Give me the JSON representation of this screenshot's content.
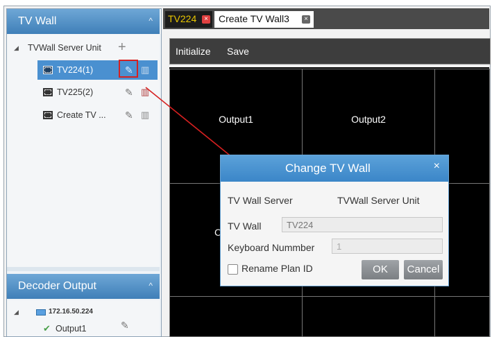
{
  "left_panel": {
    "tv_wall_header": "TV Wall",
    "server_unit_label": "TVWall Server Unit",
    "walls": [
      {
        "label": "TV224(1)"
      },
      {
        "label": "TV225(2)"
      },
      {
        "label": "Create TV ..."
      }
    ],
    "decoder_header": "Decoder Output",
    "decoder_ip": "172.16.50.224",
    "decoder_output": "Output1"
  },
  "tabs": [
    {
      "label": "TV224"
    },
    {
      "label": "Create TV Wall3"
    }
  ],
  "toolbar": {
    "initialize": "Initialize",
    "save": "Save"
  },
  "wall": {
    "output1": "Output1",
    "output2": "Output2",
    "partial_label": "C"
  },
  "dialog": {
    "title": "Change TV Wall",
    "close_symbol": "×",
    "server_label": "TV Wall Server",
    "server_value": "TVWall Server Unit",
    "wall_label": "TV Wall",
    "wall_value": "TV224",
    "keyboard_label": "Keyboard Nummber",
    "keyboard_placeholder": "1",
    "rename_label": "Rename Plan ID",
    "ok": "OK",
    "cancel": "Cancel"
  },
  "colors": {
    "header_blue": "#4a8cc6",
    "selected_row": "#4a90d0",
    "annotation_red": "#d62020",
    "tab_active_text": "#e9c600"
  }
}
